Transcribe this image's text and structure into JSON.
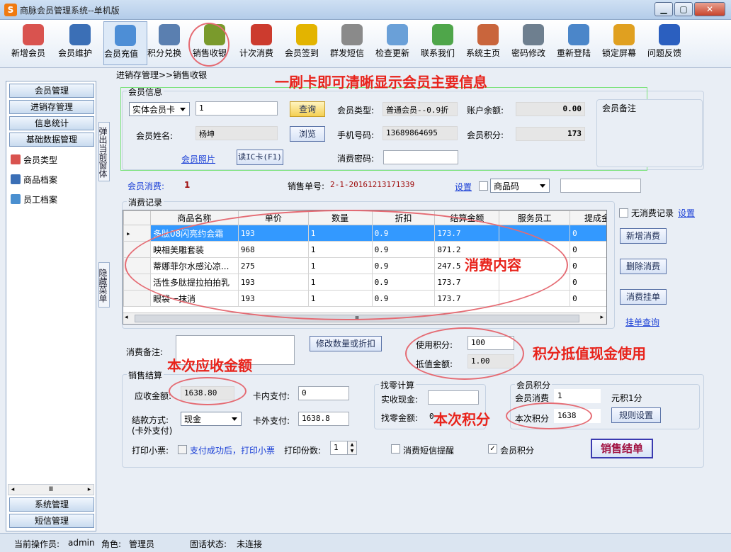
{
  "window": {
    "title": "商脉会员管理系统--单机版",
    "min": "▁",
    "max": "▢",
    "close": "✕"
  },
  "toolbar": [
    {
      "label": "新增会员",
      "icon": "add-member-icon",
      "color": "#d9534f"
    },
    {
      "label": "会员维护",
      "icon": "member-maintain-icon",
      "color": "#3b6fb6"
    },
    {
      "label": "会员充值",
      "icon": "recharge-icon",
      "color": "#4d8ed6"
    },
    {
      "label": "积分兑换",
      "icon": "points-exchange-icon",
      "color": "#5a7fb0"
    },
    {
      "label": "销售收银",
      "icon": "sales-cashier-icon",
      "color": "#7a9a2c"
    },
    {
      "label": "计次消费",
      "icon": "count-consume-icon",
      "color": "#cc3b2e"
    },
    {
      "label": "会员签到",
      "icon": "checkin-icon",
      "color": "#e3b400"
    },
    {
      "label": "群发短信",
      "icon": "sms-icon",
      "color": "#8a8a8a"
    },
    {
      "label": "检查更新",
      "icon": "update-icon",
      "color": "#6aa0d8"
    },
    {
      "label": "联系我们",
      "icon": "contact-icon",
      "color": "#4fa64a"
    },
    {
      "label": "系统主页",
      "icon": "home-icon",
      "color": "#c9653c"
    },
    {
      "label": "密码修改",
      "icon": "password-icon",
      "color": "#6e7f8f"
    },
    {
      "label": "重新登陆",
      "icon": "relogin-icon",
      "color": "#4b86c9"
    },
    {
      "label": "锁定屏幕",
      "icon": "lock-icon",
      "color": "#e0a020"
    },
    {
      "label": "问题反馈",
      "icon": "help-icon",
      "color": "#2b5fbf"
    }
  ],
  "left": {
    "nav_top": [
      "会员管理",
      "进销存管理",
      "信息统计",
      "基础数据管理"
    ],
    "tree": [
      {
        "label": "会员类型",
        "icon": "member-type-icon",
        "color": "#d9534f"
      },
      {
        "label": "商品档案",
        "icon": "product-archive-icon",
        "color": "#3b6fb6"
      },
      {
        "label": "员工档案",
        "icon": "staff-archive-icon",
        "color": "#4a8fd0"
      }
    ],
    "nav_bottom": [
      "系统管理",
      "短信管理"
    ],
    "vtab_top": "弹出当前窗体",
    "vtab_bottom": "隐藏菜单",
    "scroll_mid": "Ⅲ"
  },
  "breadcrumb": "进销存管理>>销售收银",
  "member": {
    "title": "会员信息",
    "card_type": "实体会员卡",
    "card_no": "1",
    "query": "查询",
    "type_label": "会员类型:",
    "type_value": "普通会员--0.9折",
    "balance_label": "账户余额:",
    "balance_value": "0.00",
    "name_label": "会员姓名:",
    "name_value": "杨坤",
    "browse": "浏览",
    "phone_label": "手机号码:",
    "phone_value": "13689864695",
    "points_label": "会员积分:",
    "points_value": "173",
    "photo_link": "会员照片",
    "read_card": "读IC卡(F1)",
    "password_label": "消费密码:",
    "remark_title": "会员备注"
  },
  "sale": {
    "consume_label": "会员消费:",
    "consume_value": "1",
    "order_label": "销售单号:",
    "order_value": "2-1-20161213171339",
    "settings": "设置",
    "code_type": "商品码"
  },
  "records": {
    "title": "消费记录",
    "columns": [
      "商品名称",
      "单价",
      "数量",
      "折扣",
      "结算金额",
      "服务员工",
      "提成金额"
    ],
    "rows": [
      [
        "多肽08闪亮约会霜",
        "193",
        "1",
        "0.9",
        "173.7",
        "",
        "0"
      ],
      [
        "映相美雕套装",
        "968",
        "1",
        "0.9",
        "871.2",
        "",
        "0"
      ],
      [
        "蒂娜菲尔水感沁凉...",
        "275",
        "1",
        "0.9",
        "247.5",
        "",
        "0"
      ],
      [
        "活性多肽提拉拍拍乳",
        "193",
        "1",
        "0.9",
        "173.7",
        "",
        "0"
      ],
      [
        "眼袋一抹消",
        "193",
        "1",
        "0.9",
        "173.7",
        "",
        "0"
      ]
    ],
    "no_record": "无消费记录",
    "no_record_settings": "设置",
    "add": "新增消费",
    "delete": "删除消费",
    "hang": "消费挂单",
    "hang_query": "挂单查询"
  },
  "remark": {
    "label": "消费备注:",
    "modify": "修改数量或折扣"
  },
  "points_use": {
    "use_label": "使用积分:",
    "use_value": "100",
    "offset_label": "抵值金额:",
    "offset_value": "1.00"
  },
  "settle": {
    "title": "销售结算",
    "due_label": "应收金额:",
    "due_value": "1638.80",
    "card_in_label": "卡内支付:",
    "card_in_value": "0",
    "pay_method_label": "结款方式:",
    "pay_method_label2": "(卡外支付)",
    "pay_method": "现金",
    "card_out_label": "卡外支付:",
    "card_out_value": "1638.8",
    "change_title": "找零计算",
    "cash_label": "实收现金:",
    "change_label": "找零金额:",
    "change_value": "0",
    "mp_title": "会员积分",
    "mp_consume_label": "会员消费",
    "mp_consume_value": "1",
    "mp_rate": "元积1分",
    "mp_this_label": "本次积分",
    "mp_this_value": "1638",
    "rule_settings": "规则设置",
    "print_label": "打印小票:",
    "print_after": "支付成功后，打印小票",
    "copies_label": "打印份数:",
    "copies_value": "1",
    "sms_remind": "消费短信提醒",
    "member_points": "会员积分",
    "checkout": "销售结单"
  },
  "annotations": {
    "a1": "一刷卡即可清晰显示会员主要信息",
    "a2": "消费内容",
    "a3": "积分抵值现金使用",
    "a4": "本次应收金额",
    "a5": "本次积分"
  },
  "status": {
    "operator_label": "当前操作员:",
    "operator": "admin",
    "role_label": "角色:",
    "role": "管理员",
    "phone_label": "固话状态:",
    "phone": "未连接"
  }
}
